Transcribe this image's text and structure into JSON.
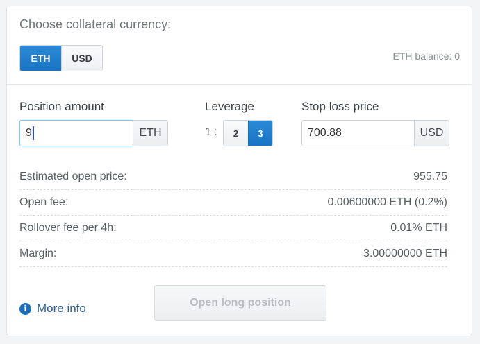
{
  "collateral": {
    "label": "Choose collateral currency:",
    "options": [
      "ETH",
      "USD"
    ],
    "selected": "ETH",
    "balance_text": "ETH balance: 0"
  },
  "position": {
    "label": "Position amount",
    "value": "9",
    "unit": "ETH"
  },
  "leverage": {
    "label": "Leverage",
    "prefix": "1 :",
    "options": [
      "2",
      "3"
    ],
    "selected": "3"
  },
  "stop_loss": {
    "label": "Stop loss price",
    "value": "700.88",
    "unit": "USD"
  },
  "details": [
    {
      "label": "Estimated open price:",
      "value": "955.75"
    },
    {
      "label": "Open fee:",
      "value": "0.00600000 ETH (0.2%)"
    },
    {
      "label": "Rollover fee per 4h:",
      "value": "0.01% ETH"
    },
    {
      "label": "Margin:",
      "value": "3.00000000 ETH"
    }
  ],
  "more_info": {
    "label": "More info",
    "icon": "info-icon"
  },
  "open_button": {
    "label": "Open long position",
    "disabled": true
  },
  "colors": {
    "accent": "#1f7acc",
    "link": "#2d5f8f"
  }
}
